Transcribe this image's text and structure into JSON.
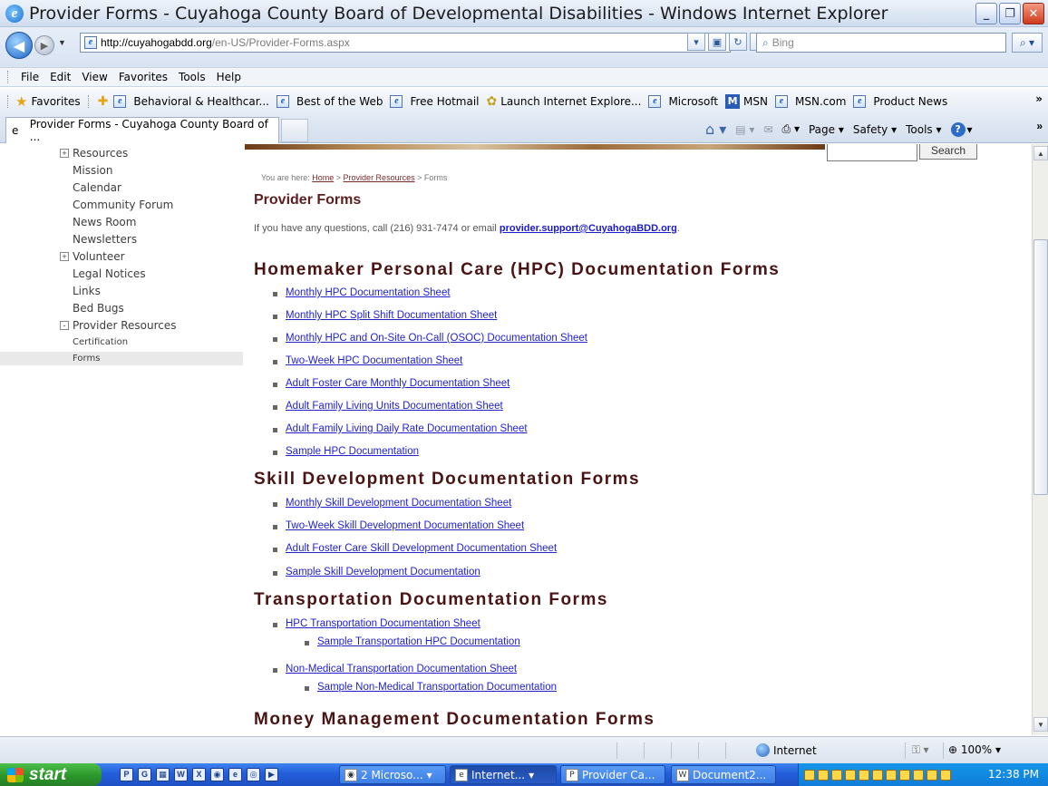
{
  "window": {
    "title": "Provider Forms - Cuyahoga County Board of Developmental Disabilities - Windows Internet Explorer"
  },
  "address": {
    "url_host": "http://cuyahogabdd.org",
    "url_path": "/en-US/Provider-Forms.aspx",
    "search_placeholder": "Bing"
  },
  "menu": [
    "File",
    "Edit",
    "View",
    "Favorites",
    "Tools",
    "Help"
  ],
  "favorites": {
    "label": "Favorites",
    "items": [
      "Behavioral & Healthcar...",
      "Best of the Web",
      "Free Hotmail",
      "Launch Internet Explore...",
      "Microsoft",
      "MSN",
      "MSN.com",
      "Product News"
    ]
  },
  "tab": {
    "label": "Provider Forms - Cuyahoga County Board of ..."
  },
  "commandbar": {
    "page": "Page",
    "safety": "Safety",
    "tools": "Tools"
  },
  "sidebar": {
    "items": [
      {
        "label": "Resources",
        "expander": "+"
      },
      {
        "label": "Mission"
      },
      {
        "label": "Calendar"
      },
      {
        "label": "Community Forum"
      },
      {
        "label": "News Room"
      },
      {
        "label": "Newsletters"
      },
      {
        "label": "Volunteer",
        "expander": "+"
      },
      {
        "label": "Legal Notices"
      },
      {
        "label": "Links"
      },
      {
        "label": "Bed Bugs"
      },
      {
        "label": "Provider Resources",
        "expander": "-"
      }
    ],
    "subitems": [
      "Certification",
      "Forms"
    ]
  },
  "site_search": {
    "button": "Search"
  },
  "content": {
    "breadcrumb": {
      "prefix": "You are here:",
      "home": "Home",
      "sep1": ">",
      "provider": "Provider Resources",
      "sep2": ">",
      "current": "Forms"
    },
    "title": "Provider Forms",
    "intro": "If you have any questions, call (216) 931-7474 or email",
    "email": "provider.support@CuyahogaBDD.org",
    "intro_end": ".",
    "sections": [
      {
        "heading": "Homemaker Personal Care (HPC) Documentation Forms",
        "links": [
          "Monthly HPC Documentation Sheet",
          "Monthly HPC Split Shift Documentation Sheet",
          "Monthly HPC and On-Site On-Call (OSOC) Documentation Sheet",
          "Two-Week HPC Documentation Sheet",
          "Adult Foster Care Monthly Documentation Sheet",
          "Adult Family Living Units Documentation Sheet",
          "Adult Family Living Daily Rate Documentation Sheet",
          "Sample HPC Documentation"
        ]
      },
      {
        "heading": "Skill Development Documentation Forms",
        "links": [
          "Monthly Skill Development Documentation Sheet",
          "Two-Week Skill Development Documentation Sheet",
          "Adult Foster Care Skill Development Documentation Sheet",
          "Sample Skill Development Documentation"
        ]
      },
      {
        "heading": "Transportation Documentation Forms",
        "links": [
          "HPC Transportation Documentation Sheet",
          "Sample Transportation HPC Documentation",
          "Non-Medical Transportation Documentation Sheet",
          "Sample Non-Medical Transportation Documentation"
        ]
      },
      {
        "heading": "Money Management Documentation Forms"
      }
    ]
  },
  "status": {
    "zone": "Internet",
    "zoom": "100%"
  },
  "taskbar": {
    "start": "start",
    "tasks": [
      "2 Microso...",
      "Internet...",
      "Provider Ca...",
      "Document2..."
    ],
    "clock": "12:38 PM"
  }
}
